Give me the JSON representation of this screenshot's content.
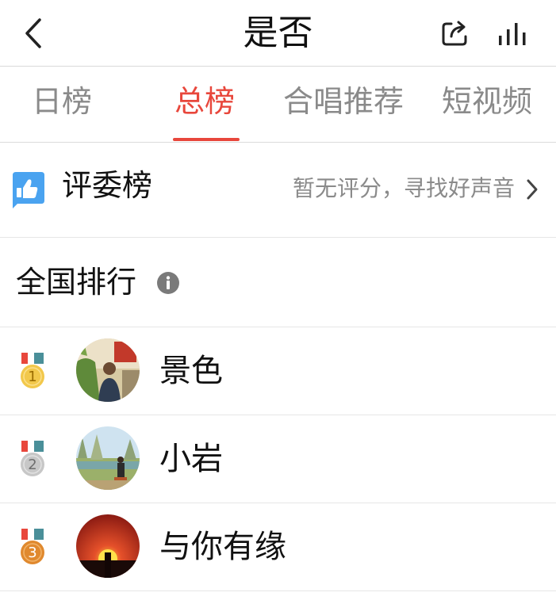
{
  "header": {
    "title": "是否",
    "back_icon": "chevron-left-icon",
    "share_icon": "share-icon",
    "stats_icon": "bar-chart-icon"
  },
  "tabs": [
    {
      "label": "日榜",
      "active": false
    },
    {
      "label": "总榜",
      "active": true
    },
    {
      "label": "合唱推荐",
      "active": false
    },
    {
      "label": "短视频",
      "active": false
    }
  ],
  "judges": {
    "label": "评委榜",
    "status": "暂无评分，寻找好声音",
    "icon": "thumbs-up-icon"
  },
  "national": {
    "label": "全国排行",
    "icon": "info-icon"
  },
  "ranking": [
    {
      "rank": "1",
      "name": "景色"
    },
    {
      "rank": "2",
      "name": "小岩"
    },
    {
      "rank": "3",
      "name": "与你有缘"
    }
  ],
  "colors": {
    "accent": "#e8473c",
    "gold": "#f2c84b",
    "silver": "#c7c7c7",
    "bronze": "#e0892e",
    "ribbon_red": "#e8473c",
    "ribbon_teal": "#4a8f99",
    "judges_blue": "#4aa3f0"
  }
}
